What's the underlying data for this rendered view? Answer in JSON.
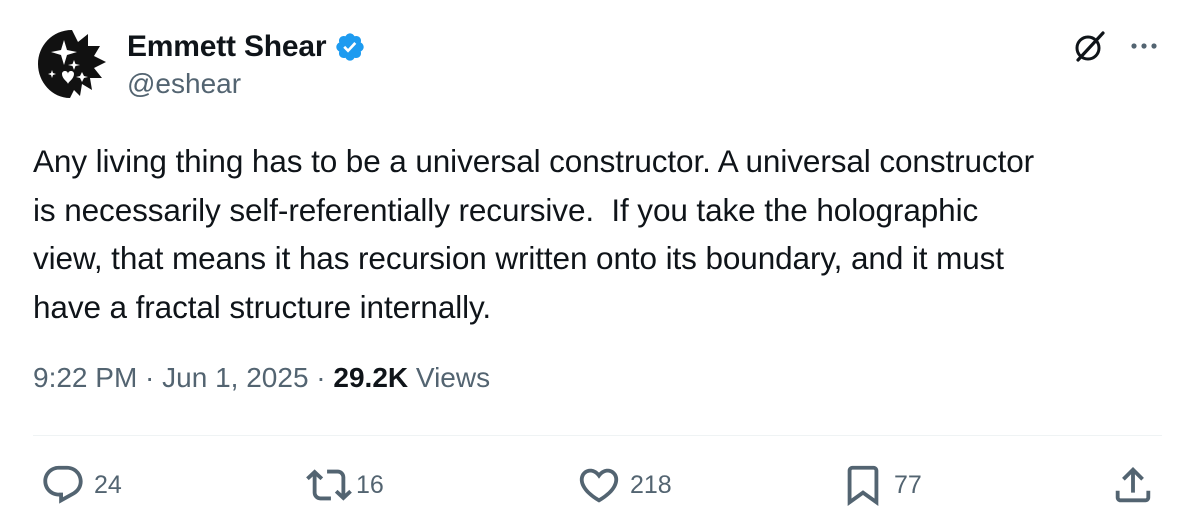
{
  "author": {
    "display_name": "Emmett Shear",
    "handle": "@eshear",
    "verified": true
  },
  "tweet": {
    "text": "Any living thing has to be a universal constructor. A universal constructor\nis necessarily self-referentially recursive.  If you take the holographic\nview, that means it has recursion written onto its boundary, and it must\nhave a fractal structure internally."
  },
  "meta": {
    "time": "9:22 PM",
    "sep1": " · ",
    "date": "Jun 1, 2025",
    "sep2": " · ",
    "views_count": "29.2K",
    "views_label": " Views"
  },
  "actions": {
    "reply_count": "24",
    "retweet_count": "16",
    "like_count": "218",
    "bookmark_count": "77"
  },
  "icons": {
    "verified": "verified-badge-icon",
    "grok": "grok-icon",
    "more": "more-icon",
    "reply": "reply-icon",
    "retweet": "retweet-icon",
    "like": "heart-icon",
    "bookmark": "bookmark-icon",
    "share": "share-icon"
  },
  "colors": {
    "text_primary": "#0f1419",
    "text_secondary": "#536471",
    "verified_blue": "#1d9bf0",
    "divider": "#eff3f4"
  }
}
